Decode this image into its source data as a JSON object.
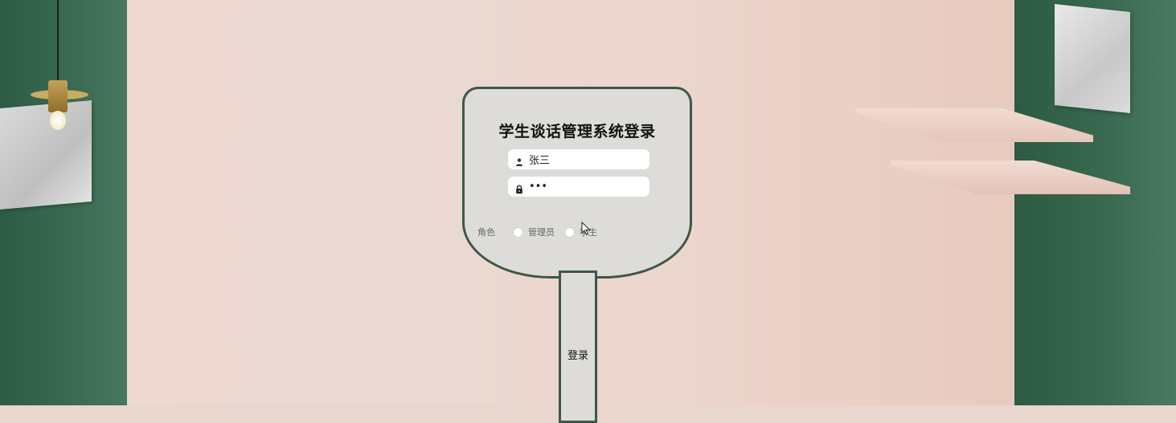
{
  "login": {
    "title": "学生谈话管理系统登录",
    "username": {
      "value": "张三",
      "icon": "user-icon"
    },
    "password": {
      "value": "•••",
      "icon": "lock-icon"
    },
    "role": {
      "label": "角色",
      "options": [
        {
          "label": "管理员",
          "selected": false
        },
        {
          "label": "学生",
          "selected": false
        }
      ]
    },
    "submit_label": "登录"
  },
  "colors": {
    "accent_border": "#3d5747",
    "card_bg": "#dedcd8",
    "wall_green": "#3a6a52",
    "wall_pink": "#ecd6ce"
  }
}
